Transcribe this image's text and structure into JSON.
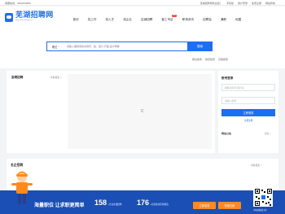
{
  "topbar": {
    "phone": "客服热线：4000153856",
    "links": [
      "芜湖招聘网欢迎您！",
      "手机版",
      "用户登录",
      "免费注册",
      "网站导航"
    ]
  },
  "header": {
    "logo_title": "芜湖招聘网",
    "logo_subtitle": "www.wuhu.zhaopin.cn",
    "nav": [
      {
        "label": "首页"
      },
      {
        "label": "找工作"
      },
      {
        "label": "找人才"
      },
      {
        "label": "找企业"
      },
      {
        "label": "店铺招聘"
      },
      {
        "label": "普工专区",
        "badge": "HOT"
      },
      {
        "label": "职场资讯"
      },
      {
        "label": "招聘会"
      },
      {
        "label": "兼职"
      },
      {
        "label": "地图"
      }
    ]
  },
  "search": {
    "category": "职位",
    "placeholder": "请输入需搜索的关键字，如：会计,行政,设计师等",
    "button": "搜索",
    "hot_links": [
      "职位搜索",
      "简历搜索",
      "高级搜索"
    ]
  },
  "left_panel": {
    "title": "急聘招聘",
    "more": "查看更多 >"
  },
  "page_mark": "1/1",
  "login": {
    "title": "账号登录",
    "username_placeholder": "邮箱/手机号/用户名",
    "password_placeholder": "请输入密码",
    "button": "立即登录",
    "register": "免费注册",
    "notice_title": "网站公告",
    "notice_more": "更多 >"
  },
  "famous": {
    "title": "名企招聘",
    "more": "查看更多 >"
  },
  "banner": {
    "headline": "海量职位 让求职更简单",
    "stats": [
      {
        "value": "158",
        "label": "+企业在线招聘"
      },
      {
        "value": "176",
        "label": "+名简职位任你挑选"
      }
    ],
    "signin": "立即登录",
    "free_register": "快速注册",
    "qr_label": "手机也能找工作"
  },
  "colors": {
    "brand": "#1e6ef2",
    "banner": "#1b4fb5",
    "accent": "#ff8a1f"
  }
}
